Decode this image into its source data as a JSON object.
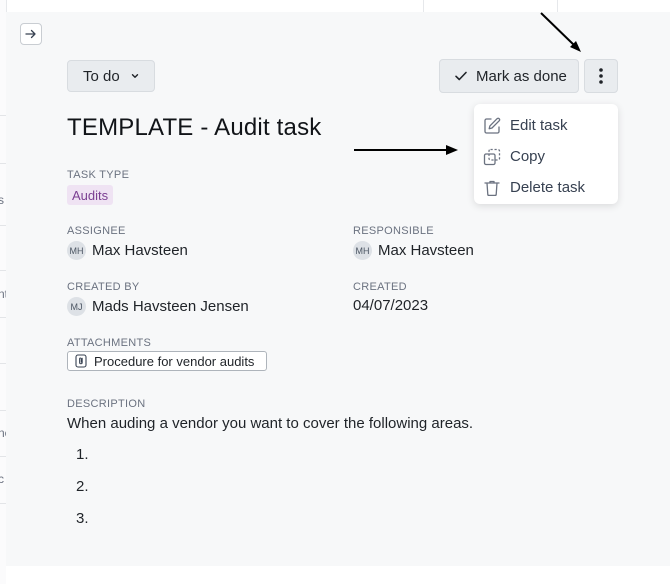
{
  "header": {
    "status_label": "To do",
    "mark_done_label": "Mark as done"
  },
  "task": {
    "title": "TEMPLATE - Audit task",
    "task_type_label": "TASK TYPE",
    "task_type": "Audits",
    "assignee_label": "ASSIGNEE",
    "assignee": {
      "initials": "MH",
      "name": "Max Havsteen"
    },
    "responsible_label": "RESPONSIBLE",
    "responsible": {
      "initials": "MH",
      "name": "Max Havsteen"
    },
    "created_by_label": "CREATED BY",
    "created_by": {
      "initials": "MJ",
      "name": "Mads Havsteen Jensen"
    },
    "created_label": "CREATED",
    "created": "04/07/2023",
    "attachments_label": "ATTACHMENTS",
    "attachments": [
      "Procedure for vendor audits"
    ],
    "description_label": "DESCRIPTION",
    "description": "When auding a vendor you want to cover the following areas.",
    "description_list": [
      "1.",
      "2.",
      "3."
    ]
  },
  "menu": {
    "items": [
      {
        "label": "Edit task",
        "icon": "edit-icon"
      },
      {
        "label": "Copy",
        "icon": "copy-icon"
      },
      {
        "label": "Delete task",
        "icon": "trash-icon"
      }
    ]
  },
  "background": {
    "left_fragments": [
      "s",
      "nt",
      "ne",
      "c"
    ]
  },
  "colors": {
    "panel_bg": "#f7f8f9",
    "tag_bg": "#efe3f3",
    "tag_text": "#7b3f92",
    "button_bg": "#e9ecef"
  }
}
